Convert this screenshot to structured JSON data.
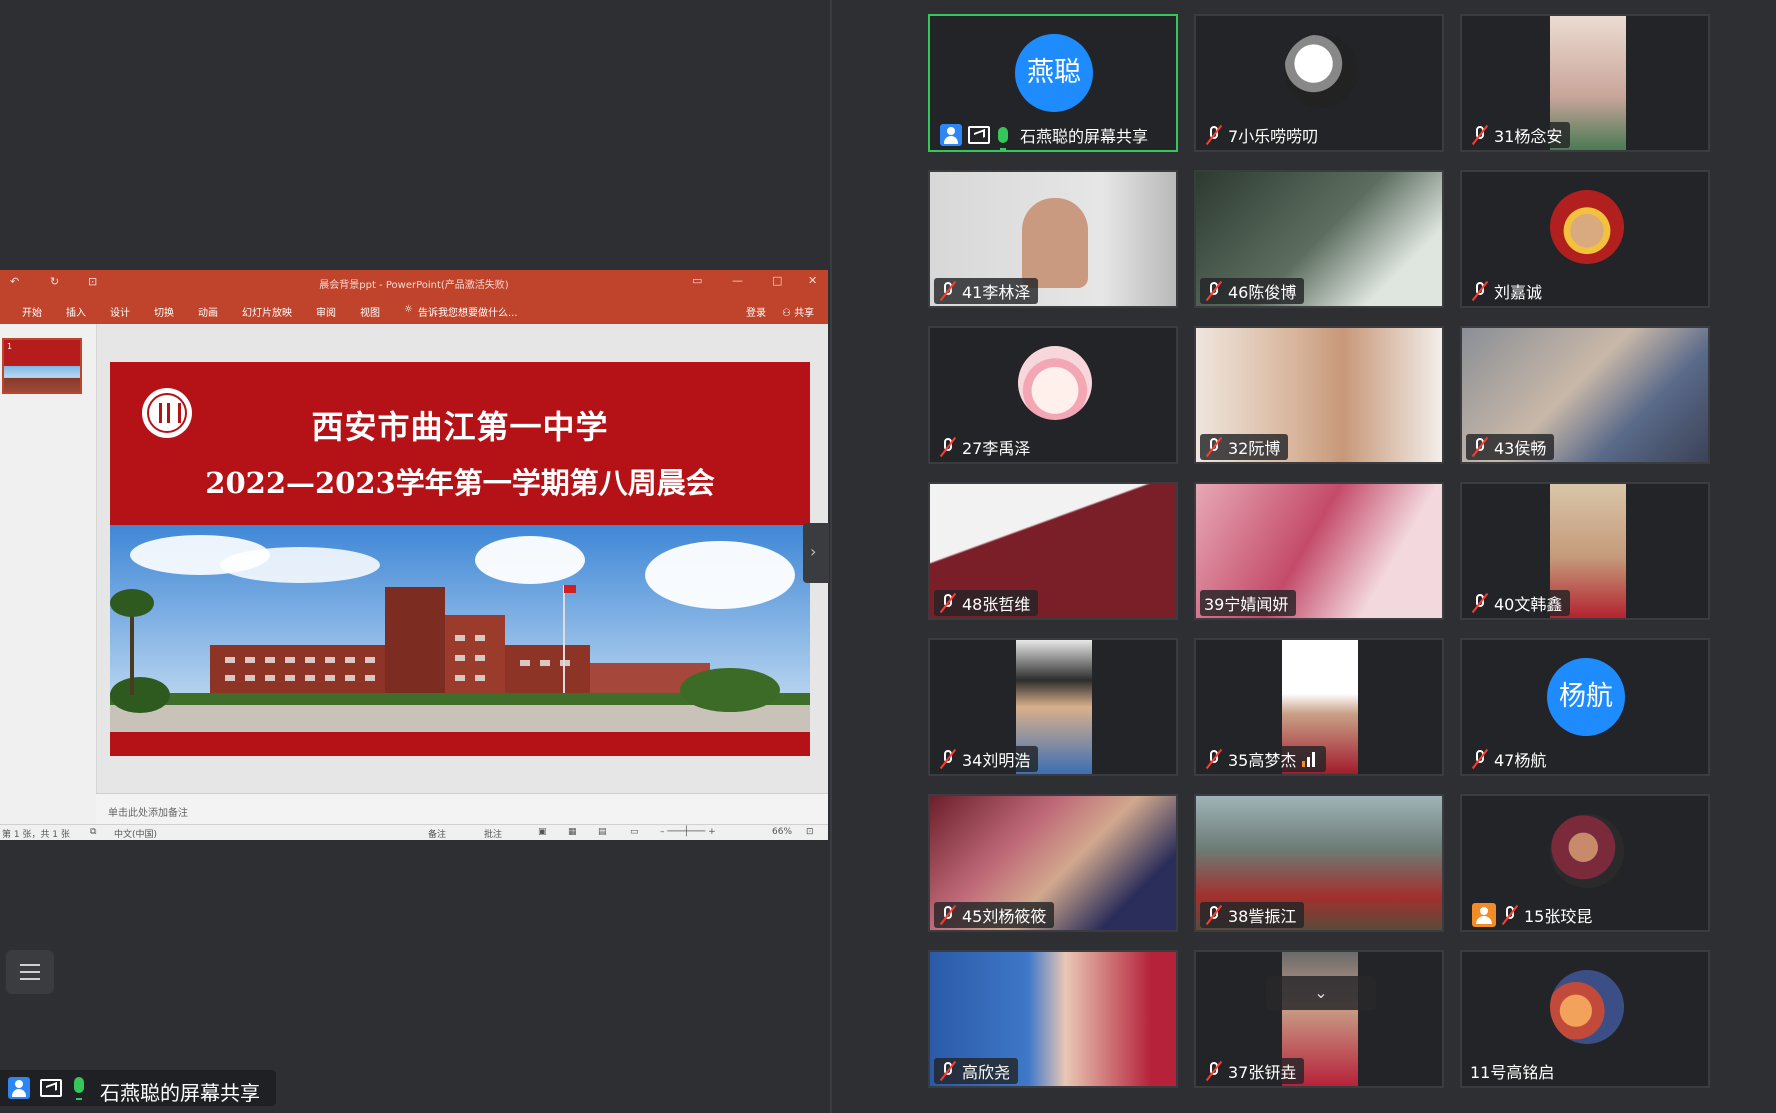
{
  "ppt": {
    "window_title": "晨会背景ppt - PowerPoint(产品激活失败)",
    "ribbon_tabs": [
      "开始",
      "插入",
      "设计",
      "切换",
      "动画",
      "幻灯片放映",
      "审阅",
      "视图"
    ],
    "tell_me": "告诉我您想要做什么...",
    "sign_in": "登录",
    "share": "共享",
    "slide_number": "1",
    "slide_title1": "西安市曲江第一中学",
    "slide_title2": "2022—2023学年第一学期第八周晨会",
    "notes_placeholder": "单击此处添加备注",
    "status": {
      "slide_count": "第 1 张，共 1 张",
      "language": "中文(中国)",
      "notes": "备注",
      "comments": "批注",
      "zoom": "66%"
    }
  },
  "share_label": "石燕聪的屏幕共享",
  "colors": {
    "accent_green": "#35c759",
    "avatar_blue": "#1e8cff",
    "ppt_red": "#c0442b",
    "slide_red": "#b51218"
  },
  "participants": [
    {
      "name": "石燕聪的屏幕共享",
      "avatar_text": "燕聪",
      "type": "avatar",
      "active": true
    },
    {
      "name": "7小乐唠唠叨",
      "type": "avatar-photo"
    },
    {
      "name": "31杨念安",
      "type": "video"
    },
    {
      "name": "41李林泽",
      "type": "video"
    },
    {
      "name": "46陈俊博",
      "type": "video"
    },
    {
      "name": "刘嘉诚",
      "type": "avatar-photo"
    },
    {
      "name": "27李禹泽",
      "type": "avatar-photo"
    },
    {
      "name": "32阮博",
      "type": "video"
    },
    {
      "name": "43侯畅",
      "type": "video"
    },
    {
      "name": "48张哲维",
      "type": "video"
    },
    {
      "name": "39宁婧闻妍",
      "type": "video"
    },
    {
      "name": "40文韩鑫",
      "type": "video"
    },
    {
      "name": "34刘明浩",
      "type": "video"
    },
    {
      "name": "35高梦杰",
      "type": "video"
    },
    {
      "name": "47杨航",
      "avatar_text": "杨航",
      "type": "avatar"
    },
    {
      "name": "45刘杨筱筱",
      "type": "video"
    },
    {
      "name": "38訾振江",
      "type": "video"
    },
    {
      "name": "15张珓昆",
      "type": "avatar-photo"
    },
    {
      "name": "高欣尧",
      "type": "video"
    },
    {
      "name": "37张钘垚",
      "type": "video"
    },
    {
      "name": "11号高铭启",
      "type": "avatar-photo"
    }
  ]
}
